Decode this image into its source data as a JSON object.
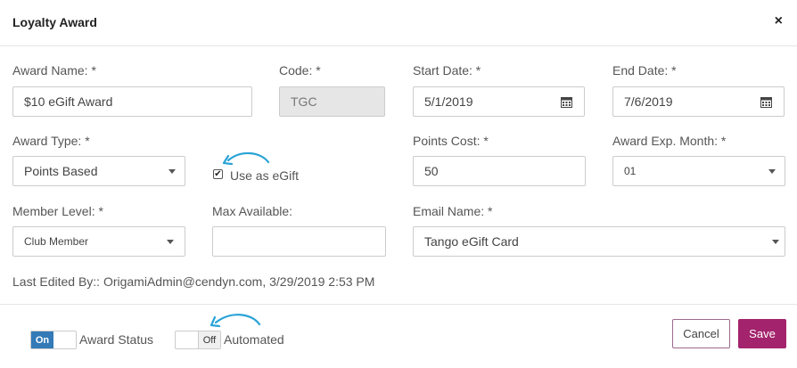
{
  "modal": {
    "title": "Loyalty Award",
    "close_label": "×"
  },
  "form": {
    "award_name": {
      "label": "Award Name: *",
      "value": "$10 eGift  Award"
    },
    "code": {
      "label": "Code: *",
      "value": "TGC"
    },
    "start_date": {
      "label": "Start Date: *",
      "value": "5/1/2019"
    },
    "end_date": {
      "label": "End Date: *",
      "value": "7/6/2019"
    },
    "award_type": {
      "label": "Award Type: *",
      "value": "Points Based"
    },
    "use_as_egift": {
      "label": "Use as eGift",
      "checked": true,
      "check_glyph": "✔"
    },
    "points_cost": {
      "label": "Points Cost: *",
      "value": "50"
    },
    "award_exp_month": {
      "label": "Award Exp. Month: *",
      "value": "01"
    },
    "member_level": {
      "label": "Member Level: *",
      "value": "Club Member"
    },
    "max_available": {
      "label": "Max Available:",
      "value": ""
    },
    "email_name": {
      "label": "Email Name: *",
      "value": "Tango eGift Card"
    }
  },
  "last_edited": "Last Edited By:: OrigamiAdmin@cendyn.com, 3/29/2019 2:53 PM",
  "footer": {
    "award_status": {
      "toggle_text": "On",
      "label": "Award Status"
    },
    "automated": {
      "toggle_text": "Off",
      "label": "Automated"
    },
    "cancel_label": "Cancel",
    "save_label": "Save"
  },
  "colors": {
    "primary": "#a3236c",
    "toggle_on": "#337ab7",
    "annotation_arrow": "#29a3d6"
  },
  "icons": {
    "calendar": "calendar-icon",
    "close": "close-icon",
    "dropdown": "chevron-down-icon",
    "annotation": "curved-arrow-icon"
  }
}
